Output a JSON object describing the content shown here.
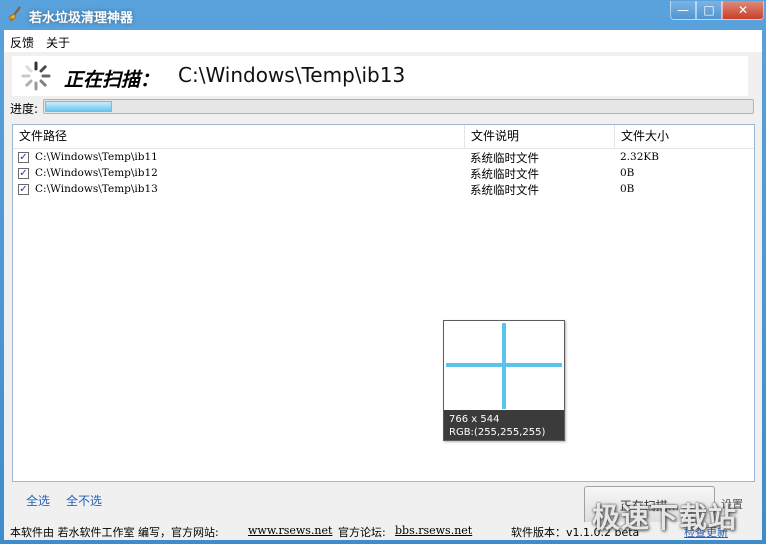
{
  "window": {
    "title": "若水垃圾清理神器",
    "controls": {
      "minimize": "—",
      "maximize": "□",
      "close": "✕"
    }
  },
  "menu": [
    {
      "label": "反馈"
    },
    {
      "label": "关于"
    }
  ],
  "scan": {
    "status_label": "正在扫描：",
    "current_path": "C:\\Windows\\Temp\\ib13"
  },
  "progress": {
    "label": "进度:",
    "fraction": 0.095
  },
  "file_list": {
    "columns": [
      "文件路径",
      "文件说明",
      "文件大小"
    ],
    "rows": [
      {
        "checked": true,
        "path": "C:\\Windows\\Temp\\ib11",
        "desc": "系统临时文件",
        "size": "2.32KB"
      },
      {
        "checked": true,
        "path": "C:\\Windows\\Temp\\ib12",
        "desc": "系统临时文件",
        "size": "0B"
      },
      {
        "checked": true,
        "path": "C:\\Windows\\Temp\\ib13",
        "desc": "系统临时文件",
        "size": "0B"
      }
    ]
  },
  "tooltip": {
    "size": "766 x 544",
    "rgb": "RGB:(255,255,255)"
  },
  "actions": {
    "select_all": "全选",
    "select_none": "全不选",
    "scan_button": "正在扫描...",
    "settings": "设置"
  },
  "status": {
    "made_by": "本软件由 若水软件工作室 编写，官方网站:",
    "website": "www.rsews.net",
    "forum_label": "官方论坛:",
    "forum": "bbs.rsews.net",
    "version": "软件版本：v1.1.0.2 beta",
    "check_update": "检查更新"
  },
  "watermark": "极速下载站",
  "colors": {
    "titlebar": "#3f8ccc",
    "progress_fill": "#6cc7f0",
    "crosshair": "#5cc3ea",
    "link": "#2562b8"
  }
}
